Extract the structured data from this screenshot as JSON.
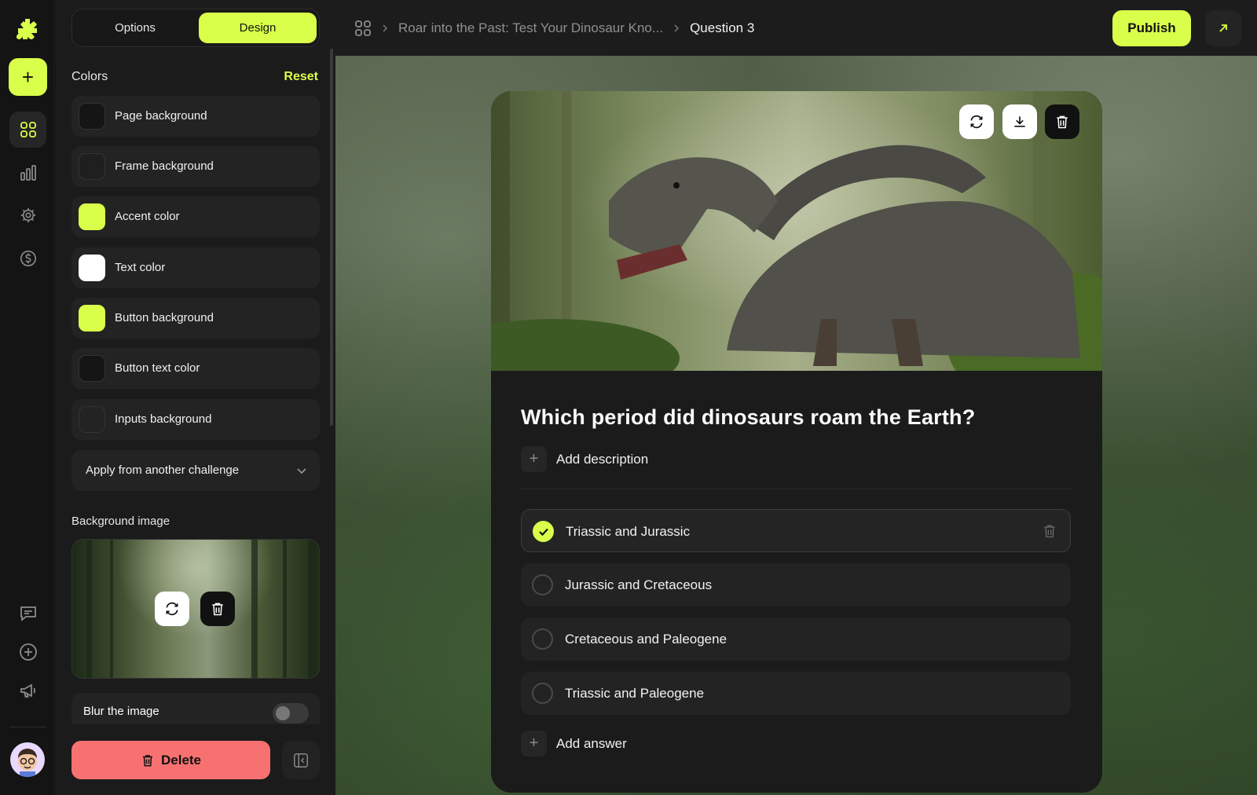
{
  "colors": {
    "accent": "#d9ff4a",
    "danger": "#f87171"
  },
  "rail": {
    "logo_icon": "plus-flower-logo",
    "add_icon": "plus-icon",
    "nav": [
      "grid-icon",
      "bar-chart-icon",
      "gear-icon",
      "dollar-icon"
    ],
    "bottom": [
      "comment-icon",
      "plus-circle-icon",
      "megaphone-icon"
    ]
  },
  "panel": {
    "tabs": {
      "options": "Options",
      "design": "Design",
      "active": "Design"
    },
    "colors_header": "Colors",
    "reset": "Reset",
    "color_rows": [
      {
        "label": "Page background",
        "swatch": "#151515"
      },
      {
        "label": "Frame background",
        "swatch": "#1f1f1f"
      },
      {
        "label": "Accent color",
        "swatch": "#d9ff4a"
      },
      {
        "label": "Text color",
        "swatch": "#ffffff"
      },
      {
        "label": "Button background",
        "swatch": "#d9ff4a"
      },
      {
        "label": "Button text color",
        "swatch": "#151515"
      },
      {
        "label": "Inputs background",
        "swatch": "#232323"
      }
    ],
    "apply_dropdown": "Apply from another challenge",
    "bg_image_header": "Background image",
    "blur_label": "Blur the image",
    "blur_on": false,
    "delete_label": "Delete"
  },
  "topbar": {
    "breadcrumb_parent": "Roar into the Past: Test Your Dinosaur Kno...",
    "breadcrumb_current": "Question 3",
    "publish": "Publish"
  },
  "question": {
    "title": "Which period did dinosaurs roam the Earth?",
    "add_description": "Add description",
    "answers": [
      {
        "text": "Triassic and Jurassic",
        "selected": true
      },
      {
        "text": "Jurassic and Cretaceous",
        "selected": false
      },
      {
        "text": "Cretaceous and Paleogene",
        "selected": false
      },
      {
        "text": "Triassic and Paleogene",
        "selected": false
      }
    ],
    "add_answer": "Add answer"
  }
}
